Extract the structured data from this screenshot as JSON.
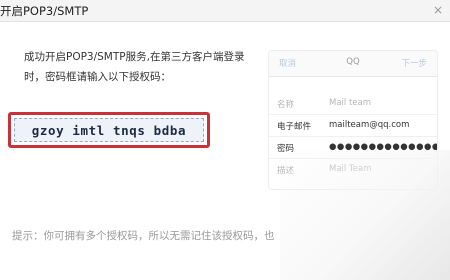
{
  "dialog": {
    "title": "开启POP3/SMTP",
    "close_glyph": "×",
    "description": "成功开启POP3/SMTP服务,在第三方客户端登录时，密码框请输入以下授权码：",
    "auth_code": "gzoy imtl tnqs bdba",
    "hint": "提示：你可拥有多个授权码，所以无需记住该授权码，也"
  },
  "phone": {
    "cancel": "取消",
    "title": "QQ",
    "next": "下一步",
    "rows": [
      {
        "label": "名称",
        "value": "Mail team",
        "muted": true
      },
      {
        "label": "电子邮件",
        "value": "mailteam@qq.com",
        "muted": false
      },
      {
        "label": "密码",
        "value": "●●●●●●●●●●●●●●●●",
        "muted": false
      },
      {
        "label": "描述",
        "value": "Mail Team",
        "muted": true
      }
    ]
  },
  "colors": {
    "highlight_border": "#c8323a",
    "code_background": "#eef3fa"
  }
}
